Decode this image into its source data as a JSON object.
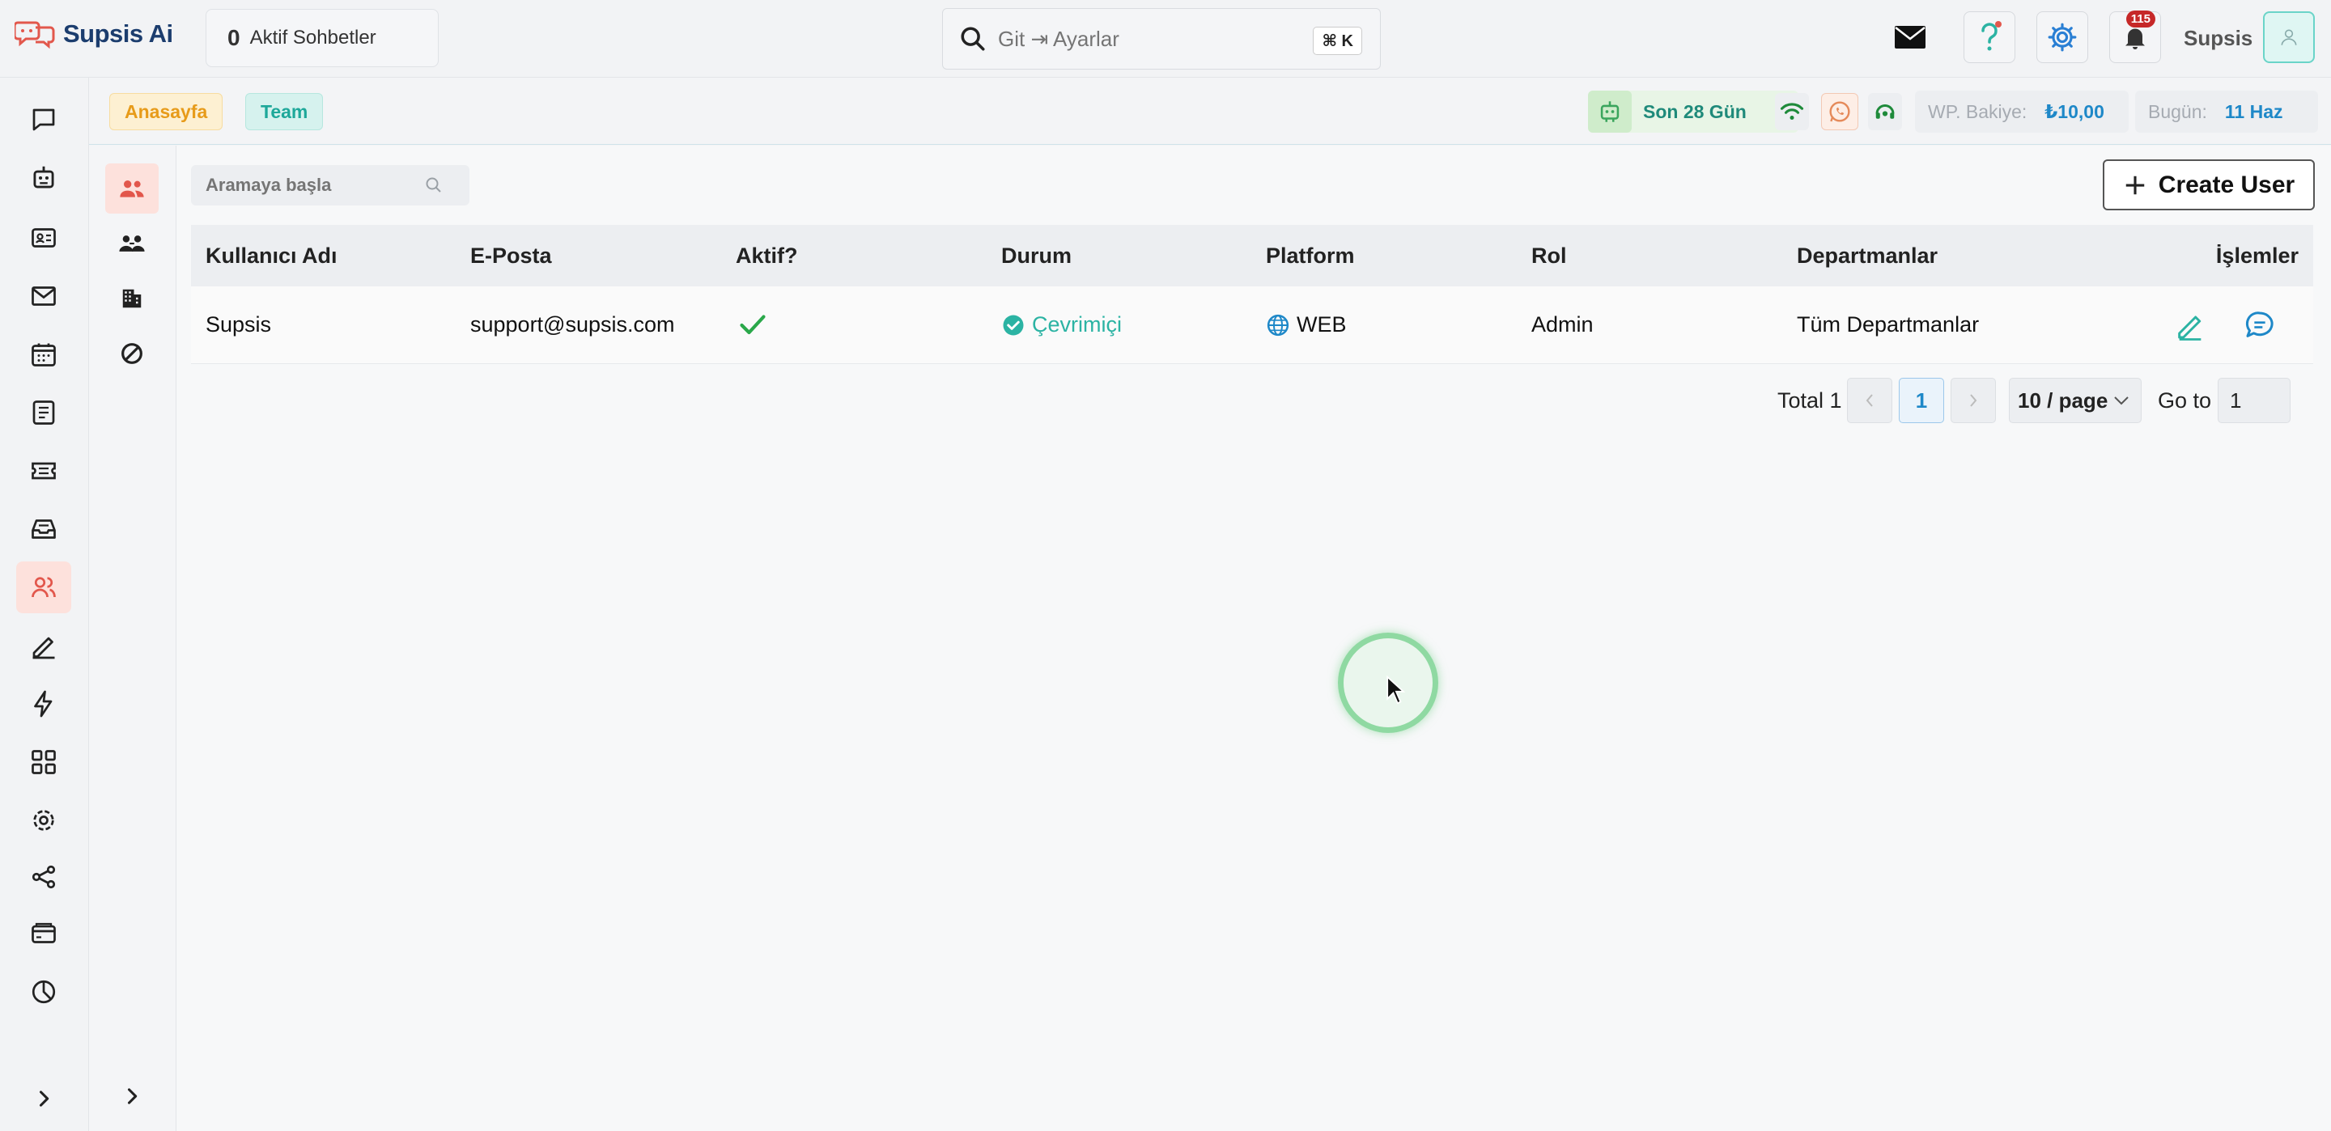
{
  "app": {
    "logo_text": "Supsis Ai"
  },
  "header": {
    "active_chats_count": "0",
    "active_chats_label": "Aktif Sohbetler",
    "search_placeholder": "Git ⇥ Ayarlar",
    "search_shortcut": "⌘ K",
    "notification_count": "115",
    "user_name": "Supsis"
  },
  "breadcrumb": {
    "home": "Anasayfa",
    "current": "Team"
  },
  "stats": {
    "period": "Son 28 Gün",
    "wp_balance_label": "WP. Bakiye:",
    "wp_balance_value": "₺10,00",
    "today_label": "Bugün:",
    "today_value": "11 Haz"
  },
  "toolbar": {
    "search_placeholder": "Aramaya başla",
    "create_user_label": "Create User"
  },
  "table": {
    "columns": [
      "Kullanıcı Adı",
      "E-Posta",
      "Aktif?",
      "Durum",
      "Platform",
      "Rol",
      "Departmanlar",
      "İşlemler"
    ],
    "rows": [
      {
        "username": "Supsis",
        "email": "support@supsis.com",
        "status": "Çevrimiçi",
        "platform": "WEB",
        "role": "Admin",
        "departments": "Tüm Departmanlar"
      }
    ]
  },
  "pagination": {
    "total_label": "Total 1",
    "current_page": "1",
    "page_size": "10 / page",
    "goto_label": "Go to",
    "goto_value": "1"
  },
  "colors": {
    "accent_teal": "#1ea89a",
    "accent_orange": "#e79b1a",
    "active_bg": "#fde1dc",
    "link_blue": "#1e88c8"
  }
}
